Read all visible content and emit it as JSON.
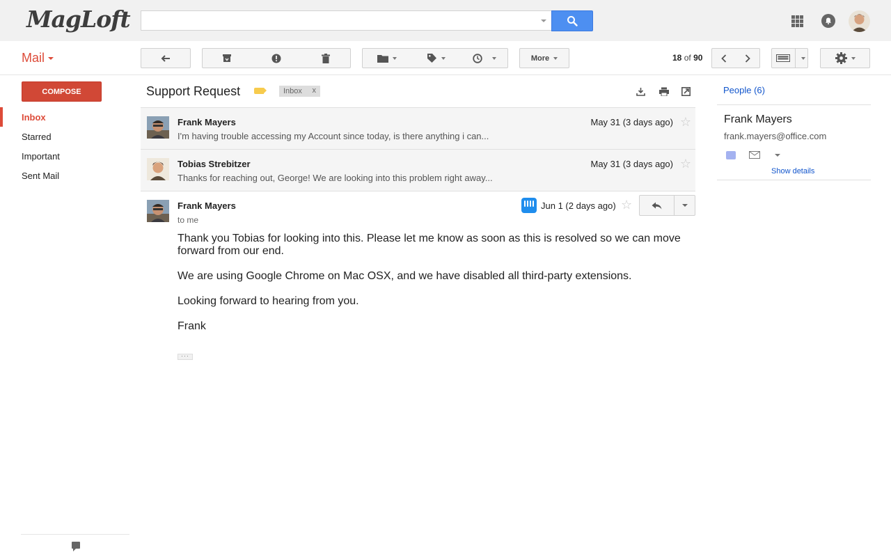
{
  "header": {
    "logo_text": "MagLoft",
    "search_placeholder": "",
    "accent_color": "#4d8ff1"
  },
  "toolbar": {
    "app_label": "Mail",
    "more_label": "More",
    "pager_current": "18",
    "pager_of": "of",
    "pager_total": "90"
  },
  "sidebar": {
    "compose_label": "COMPOSE",
    "items": [
      {
        "label": "Inbox",
        "active": true
      },
      {
        "label": "Starred"
      },
      {
        "label": "Important"
      },
      {
        "label": "Sent Mail"
      }
    ]
  },
  "conversation": {
    "subject": "Support Request",
    "label_chip": "Inbox",
    "label_chip_close": "x",
    "messages": [
      {
        "sender": "Frank Mayers",
        "snippet": "I'm having trouble accessing my Account since today, is there anything i can...",
        "date": "May 31 (3 days ago)"
      },
      {
        "sender": "Tobias Strebitzer",
        "snippet": "Thanks for reaching out, George! We are looking into this problem right away...",
        "date": "May 31 (3 days ago)"
      }
    ],
    "open_message": {
      "sender": "Frank Mayers",
      "to": "to me",
      "date": "Jun 1 (2 days ago)",
      "body": [
        "Thank you Tobias for looking into this. Please let me know as soon as this is resolved so we can move forward from our end.",
        "We are using Google Chrome on Mac OSX, and we have disabled all third-party extensions.",
        "Looking forward to hearing from you.",
        "Frank"
      ],
      "ellipsis": "···"
    }
  },
  "people_pane": {
    "people_link": "People (6)",
    "contact_name": "Frank Mayers",
    "contact_email": "frank.mayers@office.com",
    "show_details": "Show details"
  }
}
